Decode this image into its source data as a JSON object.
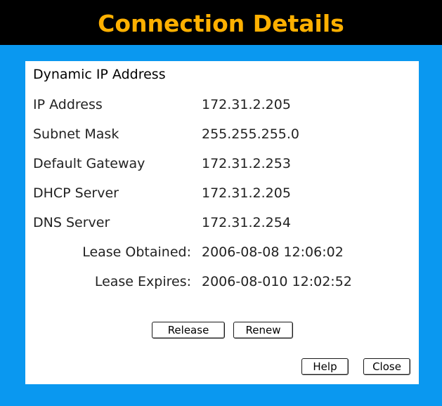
{
  "window": {
    "title": "Connection Details"
  },
  "connection": {
    "type_heading": "Dynamic IP Address",
    "rows": [
      {
        "label": "IP Address",
        "value": "172.31.2.205"
      },
      {
        "label": "Subnet Mask",
        "value": "255.255.255.0"
      },
      {
        "label": "Default Gateway",
        "value": "172.31.2.253"
      },
      {
        "label": "DHCP Server",
        "value": "172.31.2.205"
      },
      {
        "label": "DNS Server",
        "value": "172.31.2.254"
      },
      {
        "label": "Lease Obtained:",
        "value": "2006-08-08 12:06:02"
      },
      {
        "label": "Lease Expires:",
        "value": "2006-08-010 12:02:52"
      }
    ]
  },
  "actions": {
    "release_label": "Release",
    "renew_label": "Renew",
    "help_label": "Help",
    "close_label": "Close"
  },
  "colors": {
    "page_background": "#0a98f0",
    "title_background": "#000000",
    "title_text": "#ffb000",
    "panel_background": "#ffffff"
  }
}
